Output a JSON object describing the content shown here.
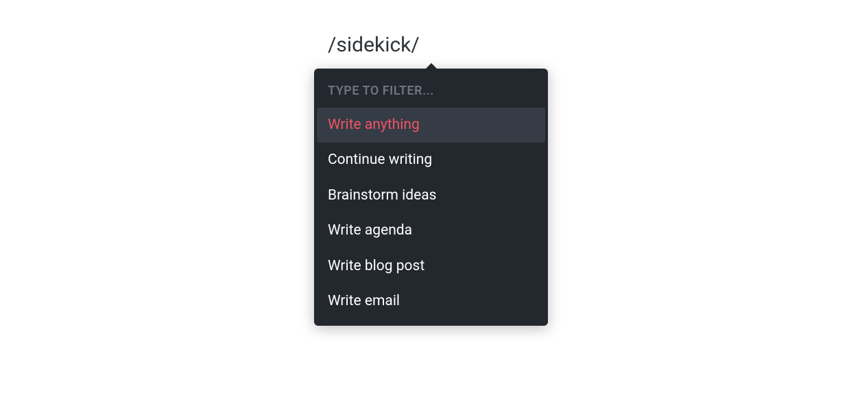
{
  "command": {
    "text": "/sidekick/"
  },
  "dropdown": {
    "filter_placeholder": "TYPE TO FILTER...",
    "items": [
      {
        "label": "Write anything",
        "selected": true
      },
      {
        "label": "Continue writing",
        "selected": false
      },
      {
        "label": "Brainstorm ideas",
        "selected": false
      },
      {
        "label": "Write agenda",
        "selected": false
      },
      {
        "label": "Write blog post",
        "selected": false
      },
      {
        "label": "Write email",
        "selected": false
      }
    ]
  }
}
